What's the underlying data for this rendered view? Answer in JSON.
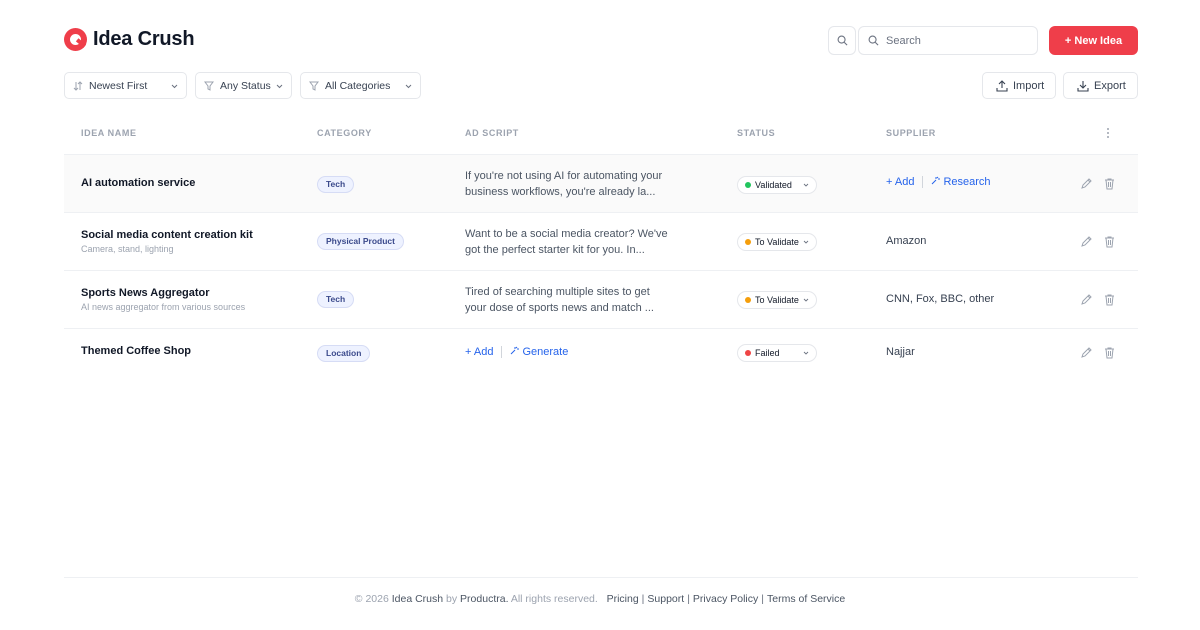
{
  "app": {
    "name": "Idea Crush",
    "accent_color": "#ef3e4a"
  },
  "header": {
    "search_placeholder": "Search",
    "new_idea_label": "+ New Idea"
  },
  "filters": {
    "sort": "Newest First",
    "status": "Any Status",
    "categories": "All Categories",
    "import_label": "Import",
    "export_label": "Export"
  },
  "table": {
    "columns": [
      "IDEA NAME",
      "CATEGORY",
      "AD SCRIPT",
      "STATUS",
      "SUPPLIER"
    ],
    "rows": [
      {
        "name": "AI automation service",
        "subtitle": "",
        "category": "Tech",
        "script_line1": "If you're not using AI for automating your",
        "script_line2": "business workflows, you're already la...",
        "status": "Validated",
        "status_color": "#22c55e",
        "supplier_add": "+ Add",
        "supplier_research": "Research"
      },
      {
        "name": "Social media content creation kit",
        "subtitle": "Camera, stand, lighting",
        "category": "Physical Product",
        "script_line1": "Want to be a social media creator? We've",
        "script_line2": "got the perfect starter kit for you. In...",
        "status": "To Validate",
        "status_color": "#f59e0b",
        "supplier": "Amazon"
      },
      {
        "name": "Sports News Aggregator",
        "subtitle": "AI news aggregator from various sources",
        "category": "Tech",
        "script_line1": "Tired of searching multiple sites to get",
        "script_line2": "your dose of sports news and match ...",
        "status": "To Validate",
        "status_color": "#f59e0b",
        "supplier": "CNN, Fox, BBC, other"
      },
      {
        "name": "Themed Coffee Shop",
        "subtitle": "",
        "category": "Location",
        "script_add": "+ Add",
        "script_generate": "Generate",
        "status": "Failed",
        "status_color": "#ef4444",
        "supplier": "Najjar"
      }
    ]
  },
  "footer": {
    "copyright_prefix": "© 2026",
    "brand": "Idea Crush",
    "by": "by",
    "company": "Productra.",
    "rights": "All rights reserved.",
    "links": [
      "Pricing",
      "Support",
      "Privacy Policy",
      "Terms of Service"
    ]
  }
}
